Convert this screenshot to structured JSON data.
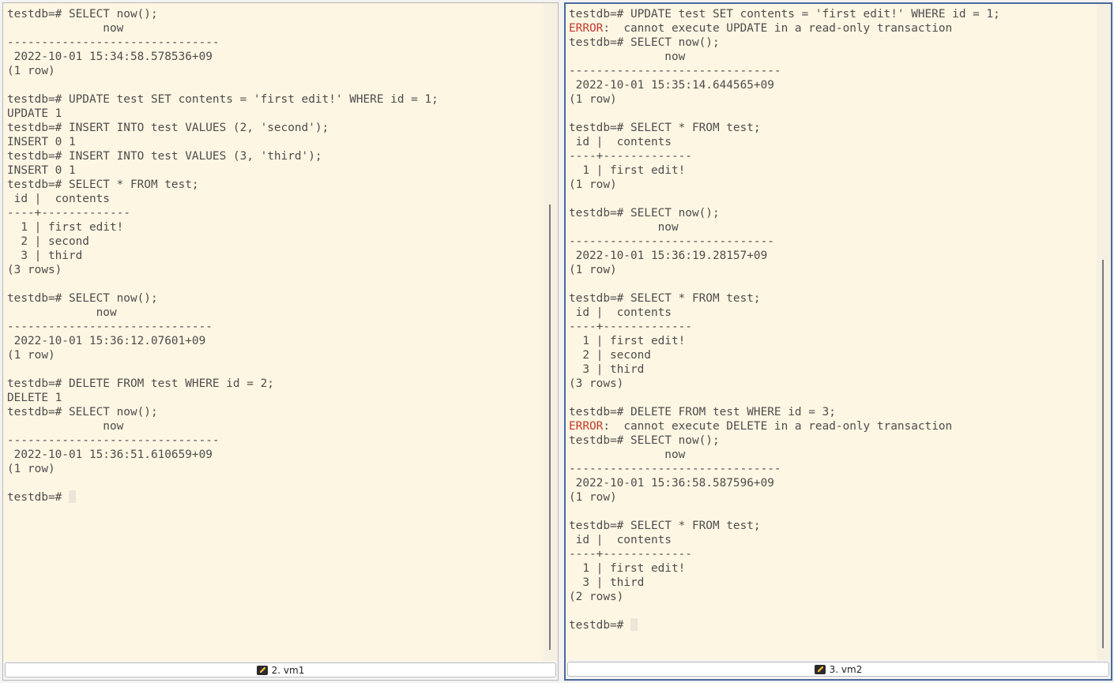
{
  "panes": [
    {
      "tab": {
        "label": "2. vm1",
        "icon": "terminal-icon"
      },
      "lines": [
        "testdb=# SELECT now();",
        "              now",
        "-------------------------------",
        " 2022-10-01 15:34:58.578536+09",
        "(1 row)",
        "",
        "testdb=# UPDATE test SET contents = 'first edit!' WHERE id = 1;",
        "UPDATE 1",
        "testdb=# INSERT INTO test VALUES (2, 'second');",
        "INSERT 0 1",
        "testdb=# INSERT INTO test VALUES (3, 'third');",
        "INSERT 0 1",
        "testdb=# SELECT * FROM test;",
        " id |  contents",
        "----+-------------",
        "  1 | first edit!",
        "  2 | second",
        "  3 | third",
        "(3 rows)",
        "",
        "testdb=# SELECT now();",
        "             now",
        "------------------------------",
        " 2022-10-01 15:36:12.07601+09",
        "(1 row)",
        "",
        "testdb=# DELETE FROM test WHERE id = 2;",
        "DELETE 1",
        "testdb=# SELECT now();",
        "              now",
        "-------------------------------",
        " 2022-10-01 15:36:51.610659+09",
        "(1 row)",
        ""
      ],
      "prompt": "testdb=# "
    },
    {
      "tab": {
        "label": "3. vm2",
        "icon": "terminal-icon"
      },
      "lines": [
        "testdb=# UPDATE test SET contents = 'first edit!' WHERE id = 1;",
        {
          "label": "ERROR",
          "text": ":  cannot execute UPDATE in a read-only transaction"
        },
        "testdb=# SELECT now();",
        "              now",
        "-------------------------------",
        " 2022-10-01 15:35:14.644565+09",
        "(1 row)",
        "",
        "testdb=# SELECT * FROM test;",
        " id |  contents",
        "----+-------------",
        "  1 | first edit!",
        "(1 row)",
        "",
        "testdb=# SELECT now();",
        "             now",
        "------------------------------",
        " 2022-10-01 15:36:19.28157+09",
        "(1 row)",
        "",
        "testdb=# SELECT * FROM test;",
        " id |  contents",
        "----+-------------",
        "  1 | first edit!",
        "  2 | second",
        "  3 | third",
        "(3 rows)",
        "",
        "testdb=# DELETE FROM test WHERE id = 3;",
        {
          "label": "ERROR",
          "text": ":  cannot execute DELETE in a read-only transaction"
        },
        "testdb=# SELECT now();",
        "              now",
        "-------------------------------",
        " 2022-10-01 15:36:58.587596+09",
        "(1 row)",
        "",
        "testdb=# SELECT * FROM test;",
        " id |  contents",
        "----+-------------",
        "  1 | first edit!",
        "  3 | third",
        "(2 rows)",
        ""
      ],
      "prompt": "testdb=# "
    }
  ],
  "colors": {
    "terminal_bg": "#fdf6e3",
    "text": "#4d4d4d",
    "error": "#c0392b",
    "active_border": "#4a6a9c"
  }
}
